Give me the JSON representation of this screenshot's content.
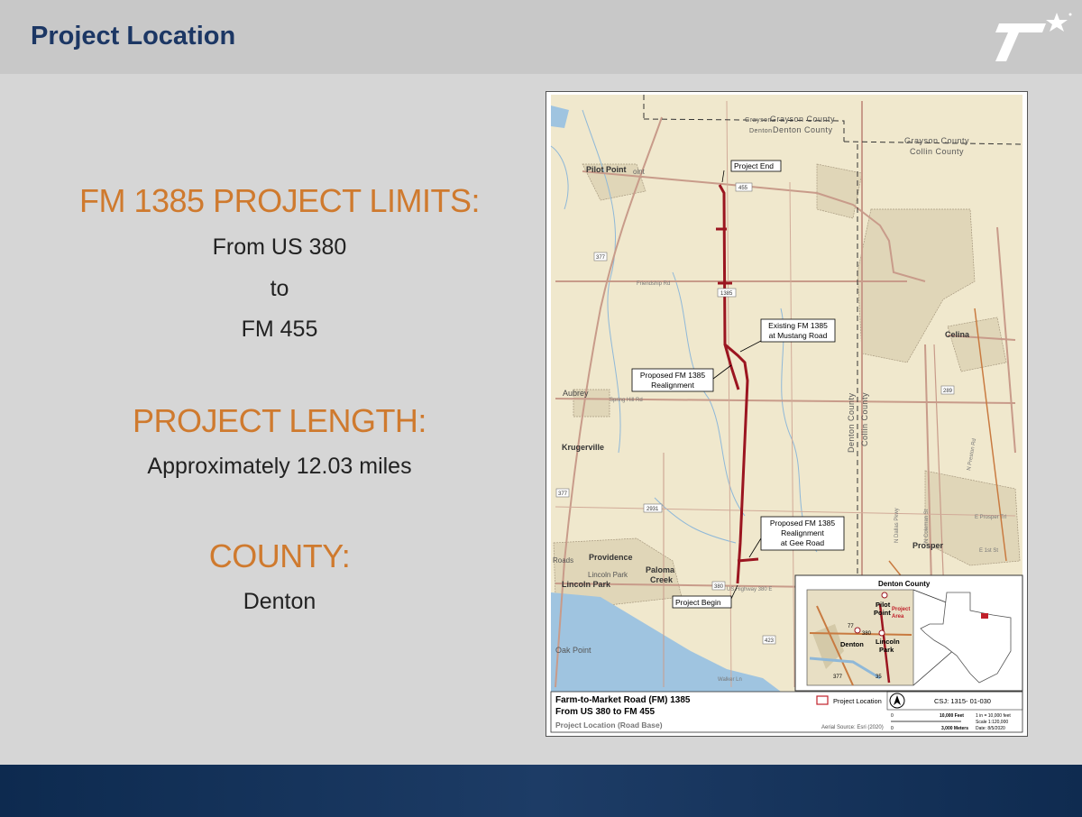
{
  "slide": {
    "title": "Project Location"
  },
  "info": {
    "limits_heading": "FM 1385 PROJECT LIMITS:",
    "limits_from": "From US 380",
    "limits_to": "to",
    "limits_end": "FM 455",
    "length_heading": "PROJECT LENGTH:",
    "length_value": "Approximately 12.03 miles",
    "county_heading": "COUNTY:",
    "county_value": "Denton"
  },
  "map": {
    "county_labels": {
      "grayson_small": "Grayson",
      "grayson_county": "Grayson County",
      "denton_small": "Denton",
      "denton_county": "Denton County",
      "grayson_county_r": "Grayson County",
      "collin_county_r": "Collin County",
      "denton_county_v": "Denton County",
      "collin_county_v": "Collin County"
    },
    "places": {
      "pilot_point": "Pilot Point",
      "pilot_point_suffix": "oint",
      "celina": "Celina",
      "aubrey": "Aubrey",
      "krugerville": "Krugerville",
      "providence": "Providence",
      "lincoln_park": "Lincoln Park",
      "lincoln_park_small": "Lincoln Park",
      "paloma": "Paloma",
      "creek": "Creek",
      "prosper": "Prosper",
      "oak_point": "Oak Point",
      "roads": "Roads"
    },
    "roads": {
      "friendship_rd": "Friendship Rd",
      "spring_hill_rd": "Spring Hill Rd",
      "us_highway_380": "US Highway 380 E",
      "walker_ln": "Walker Ln",
      "e_prosper_trl": "E Prosper Trl",
      "n_dallas_pkwy": "N Dallas Pkwy",
      "n_coleman_st": "N Coleman St",
      "e_1st_st": "E 1st St",
      "n_preston_rd": "N Preston Rd"
    },
    "shields": {
      "s455": "455",
      "s377a": "377",
      "s1385": "1385",
      "s289": "289",
      "s377b": "377",
      "s2931": "2931",
      "s380": "380",
      "s423": "423"
    },
    "callouts": {
      "project_end": "Project End",
      "existing_line1": "Existing FM 1385",
      "existing_line2": "at Mustang Road",
      "proposed1_line1": "Proposed FM 1385",
      "proposed1_line2": "Realignment",
      "proposed2_line1": "Proposed FM 1385",
      "proposed2_line2": "Realignment",
      "proposed2_line3": "at Gee Road",
      "project_begin": "Project Begin"
    },
    "inset": {
      "title": "Denton County",
      "pilot": "Pilot",
      "point": "Point",
      "denton": "Denton",
      "lincoln": "Lincoln",
      "park": "Park",
      "project": "Project",
      "area": "Area",
      "s77": "77",
      "s380": "380",
      "s377": "377",
      "s35": "35"
    },
    "legend": {
      "line1": "Farm-to-Market Road (FM) 1385",
      "line2": "From US 380 to FM 455",
      "line3": "Project Location (Road Base)",
      "project_location": "Project Location",
      "aerial_source": "Aerial Source: Esri (2020)",
      "csj": "CSJ: 1315- 01-030",
      "scale_feet_zero": "0",
      "scale_feet": "10,000 Feet",
      "scale_meters_zero": "0",
      "scale_meters": "3,000 Meters",
      "scale_ratio": "1 in = 10,000 feet",
      "scale_fraction": "Scale 1:120,000",
      "date": "Date: 8/5/2020"
    },
    "colors": {
      "project_line": "#9b1520",
      "map_bg": "#f1e9d0",
      "road": "#c89b8a",
      "water": "#8fb8d8"
    }
  }
}
